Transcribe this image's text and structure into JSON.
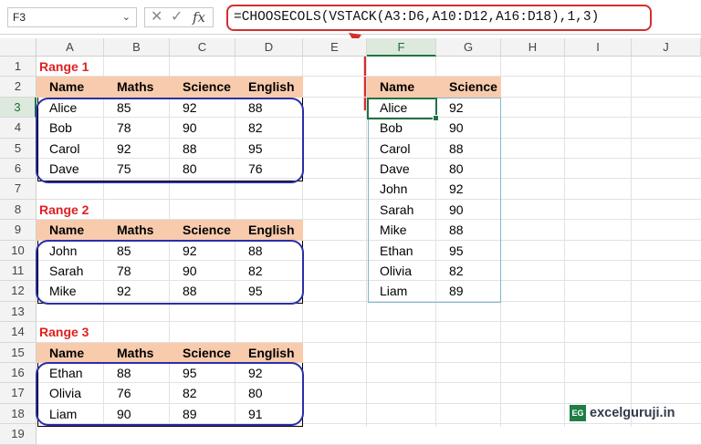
{
  "name_box": "F3",
  "formula": "=CHOOSECOLS(VSTACK(A3:D6,A10:D12,A16:D18),1,3)",
  "fx_symbol": "fx",
  "columns": [
    "A",
    "B",
    "C",
    "D",
    "E",
    "F",
    "G",
    "H",
    "I",
    "J"
  ],
  "rows": [
    "1",
    "2",
    "3",
    "4",
    "5",
    "6",
    "7",
    "8",
    "9",
    "10",
    "11",
    "12",
    "13",
    "14",
    "15",
    "16",
    "17",
    "18",
    "19"
  ],
  "headers": [
    "Name",
    "Maths",
    "Science",
    "English"
  ],
  "ranges": [
    {
      "label": "Range 1",
      "rows": [
        [
          "Alice",
          "85",
          "92",
          "88"
        ],
        [
          "Bob",
          "78",
          "90",
          "82"
        ],
        [
          "Carol",
          "92",
          "88",
          "95"
        ],
        [
          "Dave",
          "75",
          "80",
          "76"
        ]
      ]
    },
    {
      "label": "Range 2",
      "rows": [
        [
          "John",
          "85",
          "92",
          "88"
        ],
        [
          "Sarah",
          "78",
          "90",
          "82"
        ],
        [
          "Mike",
          "92",
          "88",
          "95"
        ]
      ]
    },
    {
      "label": "Range 3",
      "rows": [
        [
          "Ethan",
          "88",
          "95",
          "92"
        ],
        [
          "Olivia",
          "76",
          "82",
          "80"
        ],
        [
          "Liam",
          "90",
          "89",
          "91"
        ]
      ]
    }
  ],
  "output_headers": [
    "Name",
    "Science"
  ],
  "output_rows": [
    [
      "Alice",
      "92"
    ],
    [
      "Bob",
      "90"
    ],
    [
      "Carol",
      "88"
    ],
    [
      "Dave",
      "80"
    ],
    [
      "John",
      "92"
    ],
    [
      "Sarah",
      "90"
    ],
    [
      "Mike",
      "88"
    ],
    [
      "Ethan",
      "95"
    ],
    [
      "Olivia",
      "82"
    ],
    [
      "Liam",
      "89"
    ]
  ],
  "logo_badge": "EG",
  "logo_text": "excelguruji.in",
  "colors": {
    "header_fill": "#f8cbad",
    "range_label": "#e02020",
    "oval": "#2b2fa8",
    "formula_highlight": "#d32f2f",
    "active_cell": "#217346"
  }
}
